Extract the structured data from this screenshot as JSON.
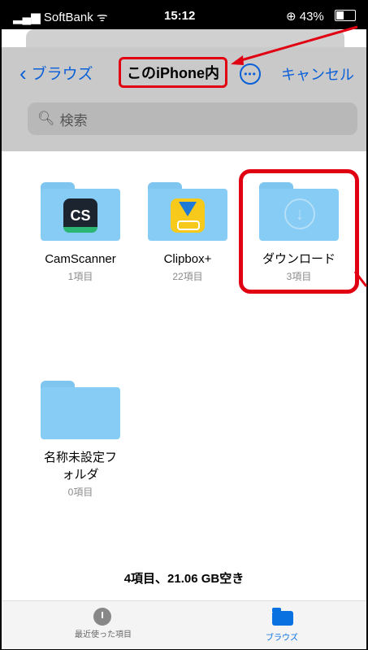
{
  "status_bar": {
    "carrier": "SoftBank",
    "time": "15:12",
    "battery": "43%"
  },
  "nav": {
    "back_label": "ブラウズ",
    "title": "このiPhone内",
    "more_icon": "ellipsis-circle-icon",
    "cancel_label": "キャンセル"
  },
  "search": {
    "placeholder": "検索"
  },
  "folders": [
    {
      "name": "CamScanner",
      "count": "1項目",
      "app_badge": "CS"
    },
    {
      "name": "Clipbox+",
      "count": "22項目"
    },
    {
      "name": "ダウンロード",
      "count": "3項目"
    },
    {
      "name_line1": "名称未設定フ",
      "name_line2": "ォルダ",
      "count": "0項目"
    }
  ],
  "storage_summary": "4項目、21.06 GB空き",
  "tab_bar": {
    "recents_label": "最近使った項目",
    "browse_label": "ブラウズ"
  },
  "colors": {
    "accent": "#0a60d8",
    "folder": "#86ccf4",
    "annotation": "#e00012"
  }
}
